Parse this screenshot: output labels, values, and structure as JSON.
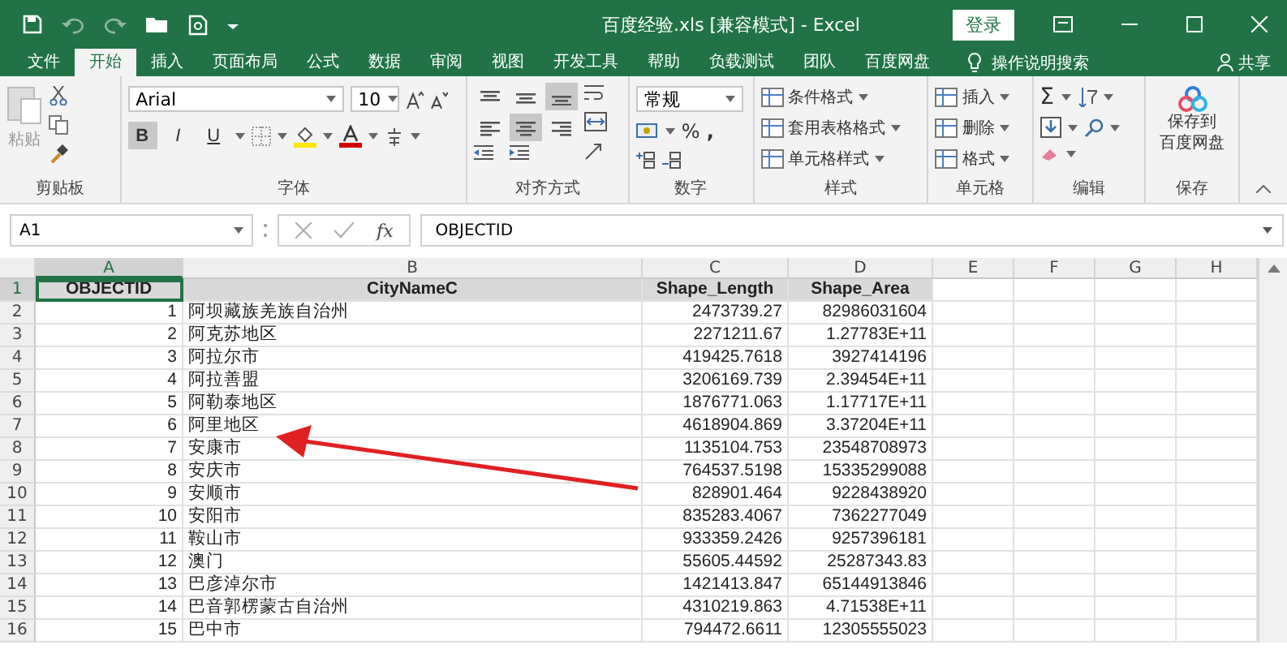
{
  "window": {
    "title": "百度经验.xls [兼容模式] - Excel",
    "sign_in": "登录"
  },
  "ribbon_tabs": [
    {
      "label": "文件",
      "selected": false
    },
    {
      "label": "开始",
      "selected": true
    },
    {
      "label": "插入",
      "selected": false
    },
    {
      "label": "页面布局",
      "selected": false
    },
    {
      "label": "公式",
      "selected": false
    },
    {
      "label": "数据",
      "selected": false
    },
    {
      "label": "审阅",
      "selected": false
    },
    {
      "label": "视图",
      "selected": false
    },
    {
      "label": "开发工具",
      "selected": false
    },
    {
      "label": "帮助",
      "selected": false
    },
    {
      "label": "负载测试",
      "selected": false
    },
    {
      "label": "团队",
      "selected": false
    },
    {
      "label": "百度网盘",
      "selected": false
    }
  ],
  "tell_me": "操作说明搜索",
  "share": "共享",
  "ribbon": {
    "clipboard": {
      "label": "剪贴板",
      "paste": "粘贴"
    },
    "font": {
      "label": "字体",
      "font_name": "Arial",
      "font_size": "10",
      "styles": [
        {
          "label": "B",
          "pressed": true
        },
        {
          "label": "I",
          "pressed": false
        },
        {
          "label": "U",
          "pressed": false
        }
      ]
    },
    "alignment": {
      "label": "对齐方式",
      "buttons": [
        {
          "kind": "top",
          "pressed": false
        },
        {
          "kind": "middle",
          "pressed": false
        },
        {
          "kind": "bottom",
          "pressed": true
        },
        {
          "kind": "left",
          "pressed": false
        },
        {
          "kind": "center",
          "pressed": true
        },
        {
          "kind": "right",
          "pressed": false
        }
      ]
    },
    "number": {
      "label": "数字",
      "format": "常规",
      "percent": "%",
      "comma": ","
    },
    "styles": {
      "label": "样式",
      "items": [
        "条件格式",
        "套用表格格式",
        "单元格样式"
      ]
    },
    "cells": {
      "label": "单元格",
      "items": [
        "插入",
        "删除",
        "格式"
      ]
    },
    "editing": {
      "label": "编辑",
      "sum": "Σ"
    },
    "save": {
      "label": "保存",
      "button_lines": [
        "保存到",
        "百度网盘"
      ]
    }
  },
  "formula_bar": {
    "name_box": "A1",
    "fx": "fx",
    "value": "OBJECTID"
  },
  "sheet": {
    "columns": [
      {
        "label": "A",
        "selected": true
      },
      {
        "label": "B",
        "selected": false
      },
      {
        "label": "C",
        "selected": false
      },
      {
        "label": "D",
        "selected": false
      },
      {
        "label": "E",
        "selected": false
      },
      {
        "label": "F",
        "selected": false
      },
      {
        "label": "G",
        "selected": false
      },
      {
        "label": "H",
        "selected": false
      }
    ],
    "rows": [
      {
        "number": "1",
        "selected": true,
        "kind": "header",
        "cells": [
          "OBJECTID",
          "CityNameC",
          "Shape_Length",
          "Shape_Area"
        ]
      },
      {
        "number": "2",
        "selected": false,
        "kind": "data",
        "cells": [
          "1",
          "阿坝藏族羌族自治州",
          "2473739.27",
          "82986031604"
        ]
      },
      {
        "number": "3",
        "selected": false,
        "kind": "data",
        "cells": [
          "2",
          "阿克苏地区",
          "2271211.67",
          "1.27783E+11"
        ]
      },
      {
        "number": "4",
        "selected": false,
        "kind": "data",
        "cells": [
          "3",
          "阿拉尔市",
          "419425.7618",
          "3927414196"
        ]
      },
      {
        "number": "5",
        "selected": false,
        "kind": "data",
        "cells": [
          "4",
          "阿拉善盟",
          "3206169.739",
          "2.39454E+11"
        ]
      },
      {
        "number": "6",
        "selected": false,
        "kind": "data",
        "cells": [
          "5",
          "阿勒泰地区",
          "1876771.063",
          "1.17717E+11"
        ]
      },
      {
        "number": "7",
        "selected": false,
        "kind": "data",
        "cells": [
          "6",
          "阿里地区",
          "4618904.869",
          "3.37204E+11"
        ]
      },
      {
        "number": "8",
        "selected": false,
        "kind": "data",
        "cells": [
          "7",
          "安康市",
          "1135104.753",
          "23548708973"
        ]
      },
      {
        "number": "9",
        "selected": false,
        "kind": "data",
        "cells": [
          "8",
          "安庆市",
          "764537.5198",
          "15335299088"
        ]
      },
      {
        "number": "10",
        "selected": false,
        "kind": "data",
        "cells": [
          "9",
          "安顺市",
          "828901.464",
          "9228438920"
        ]
      },
      {
        "number": "11",
        "selected": false,
        "kind": "data",
        "cells": [
          "10",
          "安阳市",
          "835283.4067",
          "7362277049"
        ]
      },
      {
        "number": "12",
        "selected": false,
        "kind": "data",
        "cells": [
          "11",
          "鞍山市",
          "933359.2426",
          "9257396181"
        ]
      },
      {
        "number": "13",
        "selected": false,
        "kind": "data",
        "cells": [
          "12",
          "澳门",
          "55605.44592",
          "25287343.83"
        ]
      },
      {
        "number": "14",
        "selected": false,
        "kind": "data",
        "cells": [
          "13",
          "巴彦淖尔市",
          "1421413.847",
          "65144913846"
        ]
      },
      {
        "number": "15",
        "selected": false,
        "kind": "data",
        "cells": [
          "14",
          "巴音郭楞蒙古自治州",
          "4310219.863",
          "4.71538E+11"
        ]
      },
      {
        "number": "16",
        "selected": false,
        "kind": "data",
        "cells": [
          "15",
          "巴中市",
          "794472.6611",
          "12305555023"
        ]
      }
    ]
  }
}
